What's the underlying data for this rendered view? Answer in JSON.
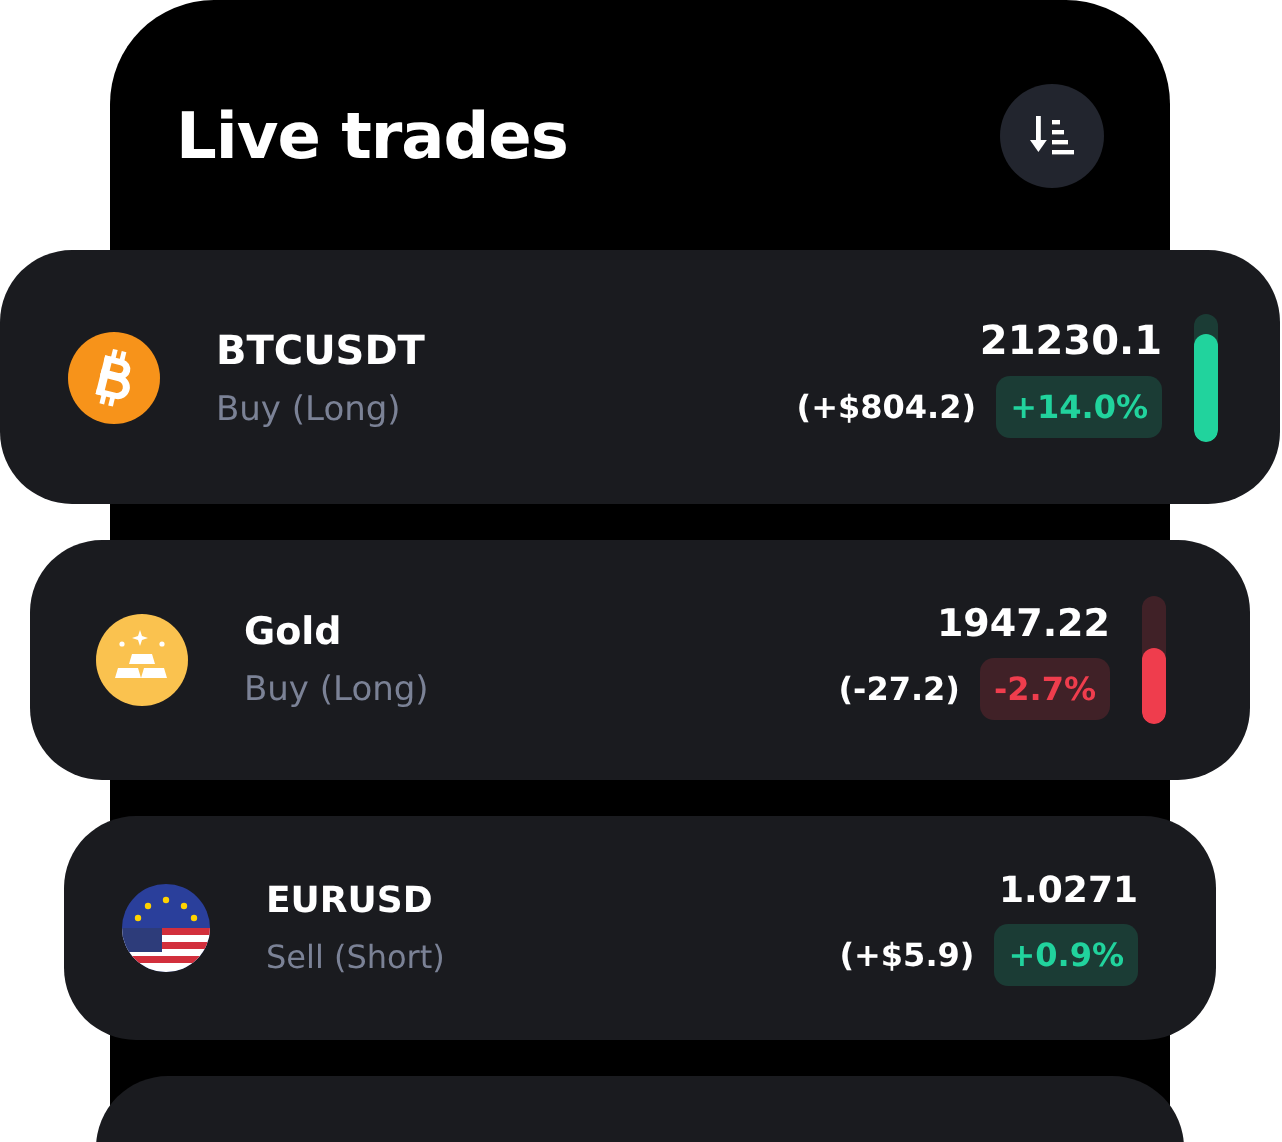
{
  "header": {
    "title": "Live trades"
  },
  "trades": [
    {
      "kind": "bitcoin",
      "name": "BTCUSDT",
      "side": "Buy (Long)",
      "price": "21230.1",
      "pnl": "(+$804.2)",
      "change": "+14.0%",
      "negative": false,
      "level": 0.83
    },
    {
      "kind": "bullion",
      "name": "Gold",
      "side": "Buy (Long)",
      "price": "1947.22",
      "pnl": "(-27.2)",
      "change": "-2.7%",
      "negative": true,
      "level": 0.6
    },
    {
      "kind": "forex",
      "name": "EURUSD",
      "side": "Sell (Short)",
      "price": "1.0271",
      "pnl": "(+$5.9)",
      "change": "+0.9%",
      "negative": false
    }
  ],
  "next_card_peek": true
}
